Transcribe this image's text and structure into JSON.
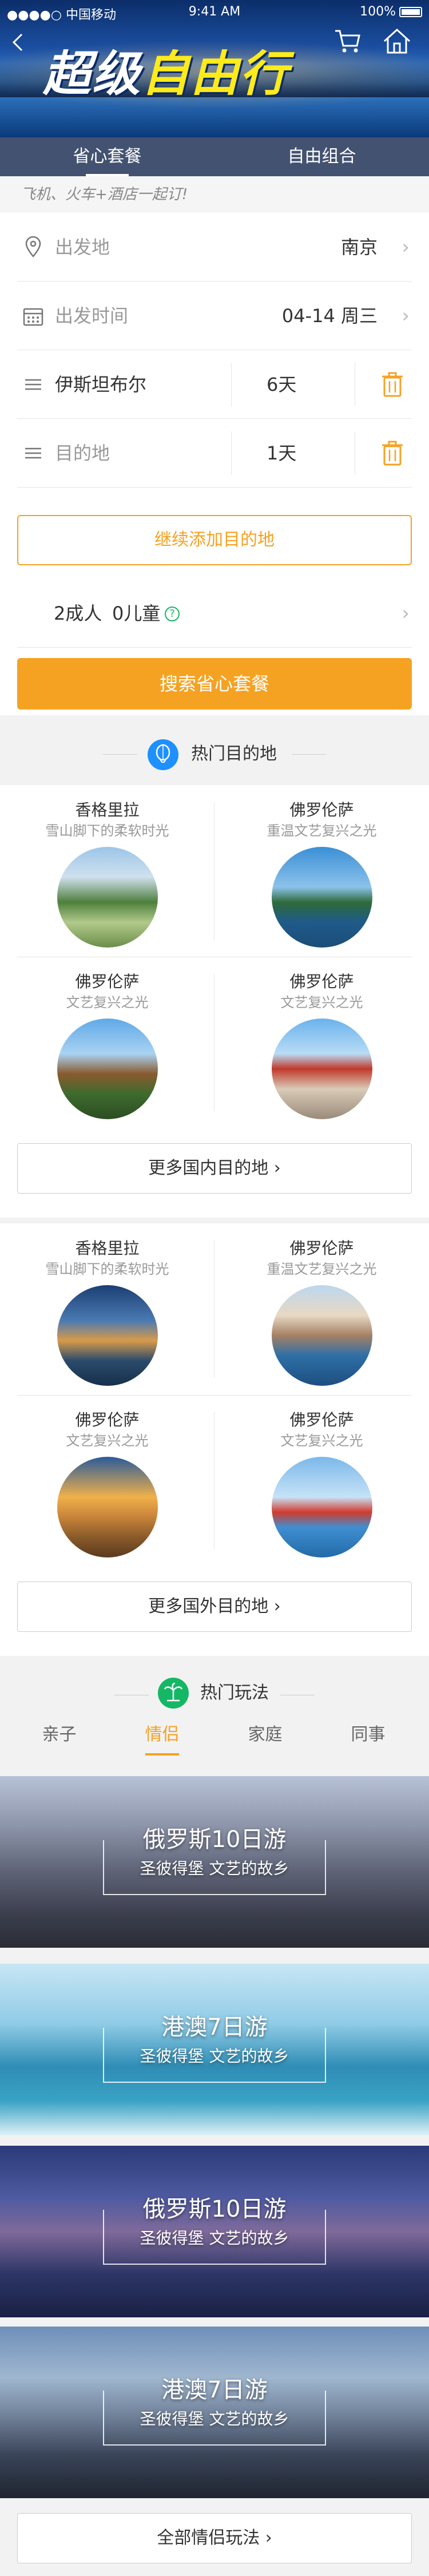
{
  "status_bar": {
    "carrier": "●●●●○ 中国移动",
    "wifi_icon": "wifi-icon",
    "time": "9:41 AM",
    "battery": "100%"
  },
  "nav": {
    "back_icon": "chevron-left-icon",
    "cart_icon": "cart-icon",
    "home_icon": "home-icon"
  },
  "hero": {
    "title_part1": "超级",
    "title_part2": "自由行"
  },
  "tabs": [
    {
      "label": "省心套餐",
      "active": true
    },
    {
      "label": "自由组合",
      "active": false
    }
  ],
  "subtitle": "飞机、火车+酒店一起订!",
  "form": {
    "departure": {
      "label": "出发地",
      "value": "南京"
    },
    "date": {
      "label": "出发时间",
      "value": "04-14 周三"
    },
    "destinations": [
      {
        "name": "伊斯坦布尔",
        "days": "6天"
      },
      {
        "name": "目的地",
        "days": "1天"
      }
    ],
    "add_button": "继续添加目的地",
    "travelers": {
      "adults": "2成人",
      "children": "0儿童",
      "help_icon": "?"
    },
    "search_button": "搜索省心套餐"
  },
  "hot_destinations": {
    "title": "热门目的地",
    "domestic": [
      {
        "name": "香格里拉",
        "desc": "雪山脚下的柔软时光"
      },
      {
        "name": "佛罗伦萨",
        "desc": "重温文艺复兴之光"
      },
      {
        "name": "佛罗伦萨",
        "desc": "文艺复兴之光"
      },
      {
        "name": "佛罗伦萨",
        "desc": "文艺复兴之光"
      }
    ],
    "more_domestic": "更多国内目的地",
    "international": [
      {
        "name": "香格里拉",
        "desc": "雪山脚下的柔软时光"
      },
      {
        "name": "佛罗伦萨",
        "desc": "重温文艺复兴之光"
      },
      {
        "name": "佛罗伦萨",
        "desc": "文艺复兴之光"
      },
      {
        "name": "佛罗伦萨",
        "desc": "文艺复兴之光"
      }
    ],
    "more_international": "更多国外目的地"
  },
  "hot_play": {
    "title": "热门玩法",
    "tabs": [
      {
        "label": "亲子"
      },
      {
        "label": "情侣",
        "active": true
      },
      {
        "label": "家庭"
      },
      {
        "label": "同事"
      }
    ],
    "cards": [
      {
        "title": "俄罗斯10日游",
        "sub": "圣彼得堡 文艺的故乡"
      },
      {
        "title": "港澳7日游",
        "sub": "圣彼得堡 文艺的故乡"
      },
      {
        "title": "俄罗斯10日游",
        "sub": "圣彼得堡 文艺的故乡"
      },
      {
        "title": "港澳7日游",
        "sub": "圣彼得堡 文艺的故乡"
      }
    ],
    "all_button": "全部情侣玩法"
  },
  "colors": {
    "accent": "#f5a223",
    "blue": "#1e90ff",
    "green": "#15b765"
  }
}
